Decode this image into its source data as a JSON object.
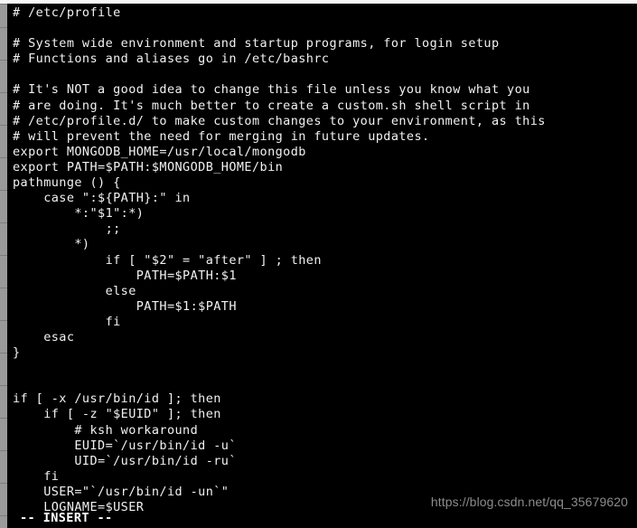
{
  "window": {
    "title": "/etc/profile",
    "editor": "vim",
    "background_color": "#000000",
    "text_color": "#f2f2f2"
  },
  "page_chrome": {
    "top_strip_color": "#f7f7f7",
    "left_gutter_color": "#9a9a9a",
    "left_gutter_rule_color": "#7d7d7d"
  },
  "buffer": {
    "lines": [
      "# /etc/profile",
      "",
      "# System wide environment and startup programs, for login setup",
      "# Functions and aliases go in /etc/bashrc",
      "",
      "# It's NOT a good idea to change this file unless you know what you",
      "# are doing. It's much better to create a custom.sh shell script in",
      "# /etc/profile.d/ to make custom changes to your environment, as this",
      "# will prevent the need for merging in future updates.",
      "export MONGODB_HOME=/usr/local/mongodb",
      "export PATH=$PATH:$MONGODB_HOME/bin",
      "pathmunge () {",
      "    case \":${PATH}:\" in",
      "        *:\"$1\":*)",
      "            ;;",
      "        *)",
      "            if [ \"$2\" = \"after\" ] ; then",
      "                PATH=$PATH:$1",
      "            else",
      "                PATH=$1:$PATH",
      "            fi",
      "    esac",
      "}",
      "",
      "",
      "if [ -x /usr/bin/id ]; then",
      "    if [ -z \"$EUID\" ]; then",
      "        # ksh workaround",
      "        EUID=`/usr/bin/id -u`",
      "        UID=`/usr/bin/id -ru`",
      "    fi",
      "    USER=\"`/usr/bin/id -un`\"",
      "    LOGNAME=$USER"
    ]
  },
  "status": {
    "mode_text": "-- INSERT --",
    "mode_color": "#ffffff"
  },
  "watermark": {
    "text": "https://blog.csdn.net/qq_35679620",
    "color": "#8c8c8c"
  }
}
